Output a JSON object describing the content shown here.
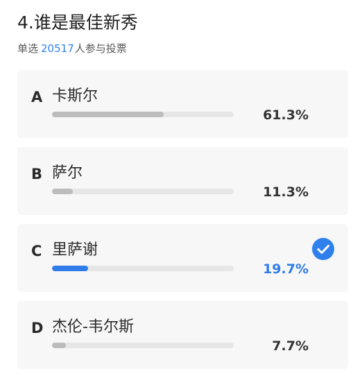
{
  "poll": {
    "title": "4.谁是最佳新秀",
    "mode_label": "单选",
    "participant_count": "20517",
    "participant_suffix": "人参与投票",
    "options": [
      {
        "letter": "A",
        "name": "卡斯尔",
        "percent_label": "61.3%",
        "fraction": 0.613,
        "selected": false
      },
      {
        "letter": "B",
        "name": "萨尔",
        "percent_label": "11.3%",
        "fraction": 0.113,
        "selected": false
      },
      {
        "letter": "C",
        "name": "里萨谢",
        "percent_label": "19.7%",
        "fraction": 0.197,
        "selected": true,
        "check_icon": "check-circle-icon"
      },
      {
        "letter": "D",
        "name": "杰伦-韦尔斯",
        "percent_label": "7.7%",
        "fraction": 0.077,
        "selected": false
      }
    ]
  },
  "colors": {
    "accent": "#2f80ed",
    "bar_default": "#bcbcbc",
    "bar_track": "#e6e6e6",
    "card_bg": "#f7f7f7"
  }
}
